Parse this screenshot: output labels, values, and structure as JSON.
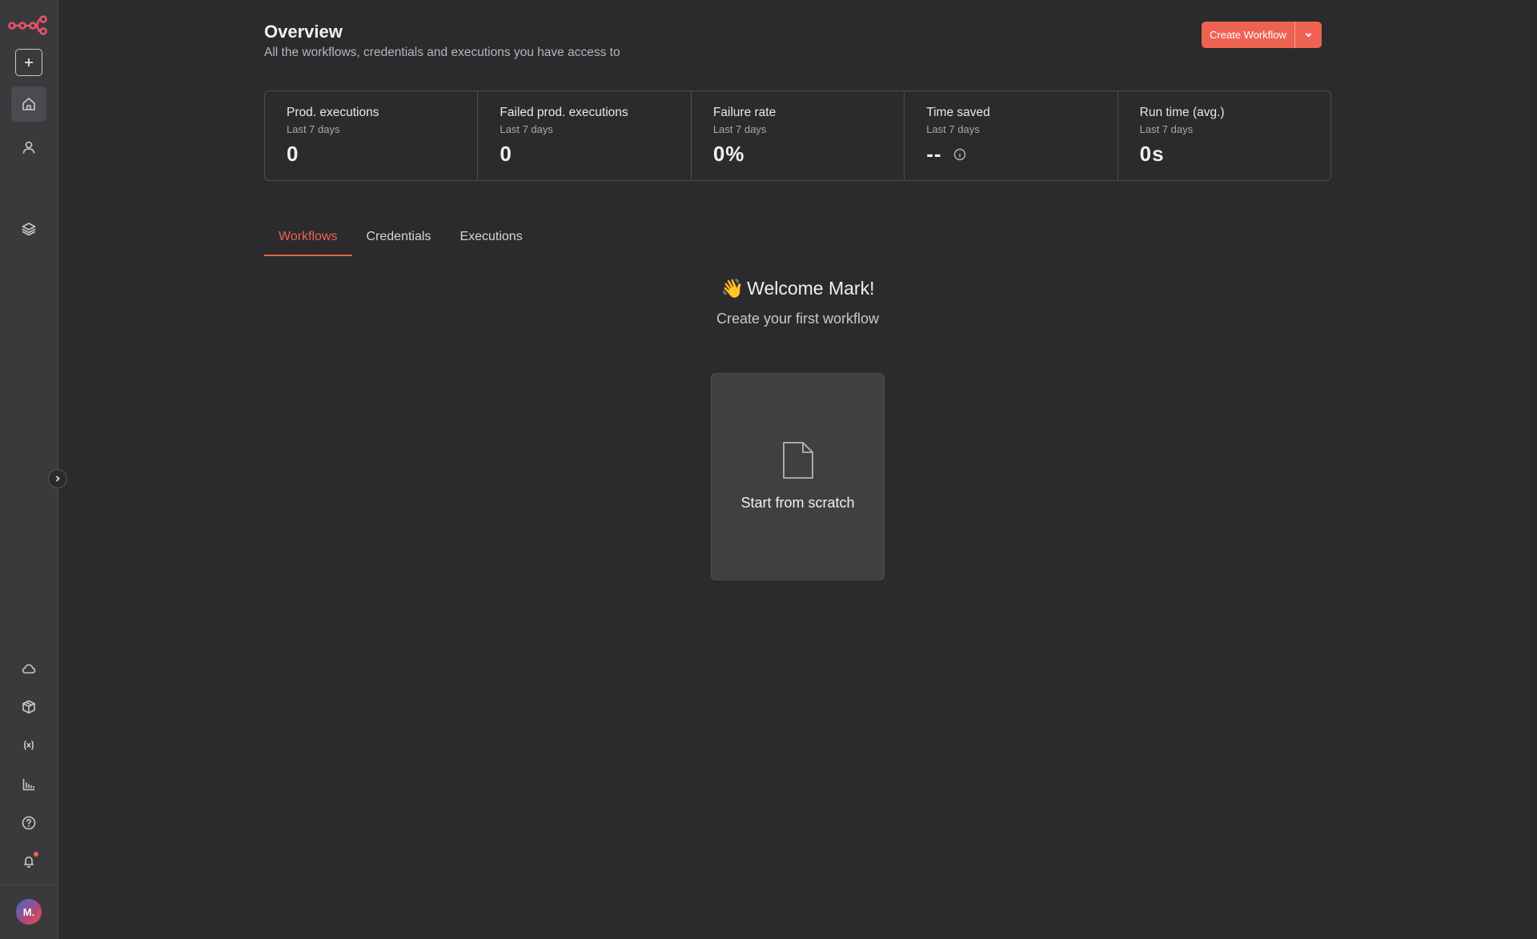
{
  "header": {
    "title": "Overview",
    "subtitle": "All the workflows, credentials and executions you have access to",
    "create_label": "Create Workflow"
  },
  "stats": [
    {
      "label": "Prod. executions",
      "period": "Last 7 days",
      "value": "0"
    },
    {
      "label": "Failed prod. executions",
      "period": "Last 7 days",
      "value": "0"
    },
    {
      "label": "Failure rate",
      "period": "Last 7 days",
      "value": "0%"
    },
    {
      "label": "Time saved",
      "period": "Last 7 days",
      "value": "--"
    },
    {
      "label": "Run time (avg.)",
      "period": "Last 7 days",
      "value": "0s"
    }
  ],
  "tabs": [
    {
      "label": "Workflows",
      "active": true
    },
    {
      "label": "Credentials",
      "active": false
    },
    {
      "label": "Executions",
      "active": false
    }
  ],
  "welcome": {
    "emoji": "👋",
    "title": "Welcome Mark!",
    "subtitle": "Create your first workflow"
  },
  "scratch": {
    "label": "Start from scratch"
  },
  "user": {
    "initials": "M."
  },
  "colors": {
    "accent": "#ee6251",
    "background": "#2b2b2e",
    "sidebar": "#3a3a3d"
  },
  "sidebar_icons": [
    "logo-icon",
    "plus-icon",
    "home-icon",
    "user-icon",
    "layers-icon",
    "cloud-icon",
    "package-icon",
    "variables-icon",
    "chart-icon",
    "help-icon",
    "bell-icon"
  ]
}
